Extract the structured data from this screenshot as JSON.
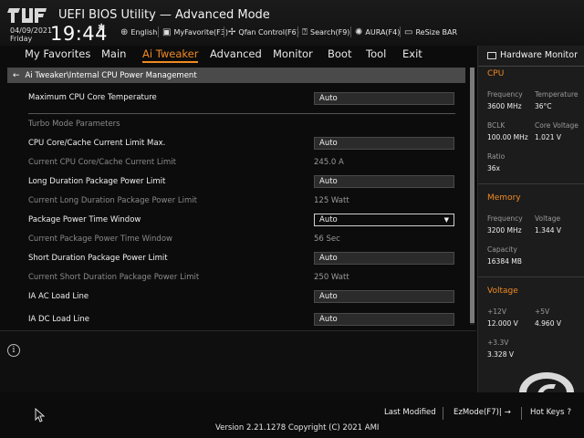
{
  "header": {
    "title": "UEFI BIOS Utility — Advanced Mode",
    "date": "04/09/2021",
    "day": "Friday",
    "time": "19:44",
    "toolbar": [
      {
        "label": "English",
        "icon": "globe-icon"
      },
      {
        "label": "MyFavorite(F3)",
        "icon": "favorite-icon"
      },
      {
        "label": "Qfan Control(F6)",
        "icon": "fan-icon"
      },
      {
        "label": "Search(F9)",
        "icon": "search-icon"
      },
      {
        "label": "AURA(F4)",
        "icon": "aura-icon"
      },
      {
        "label": "ReSize BAR",
        "icon": "resize-bar-icon"
      }
    ]
  },
  "menu": {
    "items": [
      "My Favorites",
      "Main",
      "Ai Tweaker",
      "Advanced",
      "Monitor",
      "Boot",
      "Tool",
      "Exit"
    ],
    "active": "Ai Tweaker"
  },
  "breadcrumb": "Ai Tweaker\\Internal CPU Power Management",
  "settings": {
    "max_cpu_temp": {
      "label": "Maximum CPU Core Temperature",
      "value": "Auto"
    },
    "turbo_header": "Turbo Mode Parameters",
    "core_cache_limit": {
      "label": "CPU Core/Cache Current Limit Max.",
      "value": "Auto"
    },
    "current_core_cache": {
      "label": "Current CPU Core/Cache Current Limit",
      "value": "245.0 A"
    },
    "long_power": {
      "label": "Long Duration Package Power Limit",
      "value": "Auto"
    },
    "current_long_power": {
      "label": "Current Long Duration Package Power Limit",
      "value": "125 Watt"
    },
    "time_window": {
      "label": "Package Power Time Window",
      "value": "Auto"
    },
    "current_time_window": {
      "label": "Current Package Power Time Window",
      "value": "56 Sec"
    },
    "short_power": {
      "label": "Short Duration Package Power Limit",
      "value": "Auto"
    },
    "current_short_power": {
      "label": "Current Short Duration Package Power Limit",
      "value": "250 Watt"
    },
    "ia_ac": {
      "label": "IA AC Load Line",
      "value": "Auto"
    },
    "ia_dc": {
      "label": "IA DC Load Line",
      "value": "Auto"
    }
  },
  "hardware_monitor": {
    "title": "Hardware Monitor",
    "cpu": {
      "section": "CPU",
      "frequency_label": "Frequency",
      "frequency": "3600 MHz",
      "temperature_label": "Temperature",
      "temperature": "36°C",
      "bclk_label": "BCLK",
      "bclk": "100.00 MHz",
      "core_voltage_label": "Core Voltage",
      "core_voltage": "1.021 V",
      "ratio_label": "Ratio",
      "ratio": "36x"
    },
    "memory": {
      "section": "Memory",
      "frequency_label": "Frequency",
      "frequency": "3200 MHz",
      "voltage_label": "Voltage",
      "voltage": "1.344 V",
      "capacity_label": "Capacity",
      "capacity": "16384 MB"
    },
    "voltage": {
      "section": "Voltage",
      "v12_label": "+12V",
      "v12": "12.000 V",
      "v5_label": "+5V",
      "v5": "4.960 V",
      "v33_label": "+3.3V",
      "v33": "3.328 V"
    }
  },
  "footer": {
    "last_modified": "Last Modified",
    "ezmode": "EzMode(F7)|",
    "hotkeys": "Hot Keys",
    "version": "Version 2.21.1278 Copyright (C) 2021 AMI"
  },
  "colors": {
    "accent": "#f08a24",
    "background": "#0c0c0c",
    "panel": "#1c1c1c"
  }
}
